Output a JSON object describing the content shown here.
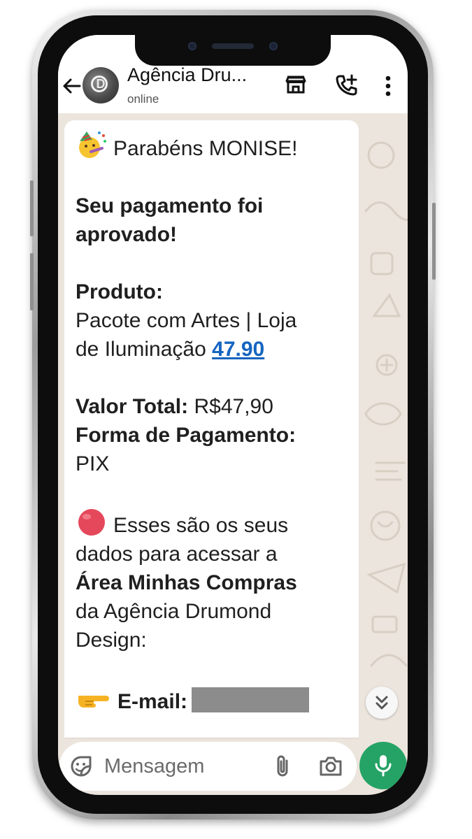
{
  "header": {
    "contact_name": "Agência Dru...",
    "status": "online",
    "avatar_initial": "D"
  },
  "message": {
    "greeting": "Parabéns MONISE!",
    "approved_line1": "Seu pagamento foi",
    "approved_line2": "aprovado!",
    "product_label": "Produto:",
    "product_line1": "Pacote com Artes | Loja",
    "product_line2": "de Iluminação",
    "product_price_link": "47.90",
    "total_label": "Valor Total:",
    "total_value": "R$47,90",
    "payment_label": "Forma de Pagamento:",
    "payment_value": "PIX",
    "access_line1": "Esses são os seus",
    "access_line2": "dados para acessar a",
    "access_area": "Área Minhas Compras",
    "access_line4": "da Agência Drumond",
    "access_line5": "Design:",
    "email_label": "E-mail:"
  },
  "input": {
    "placeholder": "Mensagem"
  },
  "icons": {
    "back": "arrow-left-icon",
    "store": "store-icon",
    "call": "phone-add-icon",
    "menu": "more-vertical-icon",
    "party": "partying-face-emoji",
    "red_circle": "red-circle-emoji",
    "pointing": "pointing-right-emoji",
    "scroll": "chevrons-down-icon",
    "sticker": "sticker-icon",
    "attach": "paperclip-icon",
    "camera": "camera-icon",
    "mic": "microphone-icon"
  },
  "colors": {
    "link": "#1565c0",
    "mic_button": "#25a366",
    "chat_background": "#ece5dd"
  }
}
